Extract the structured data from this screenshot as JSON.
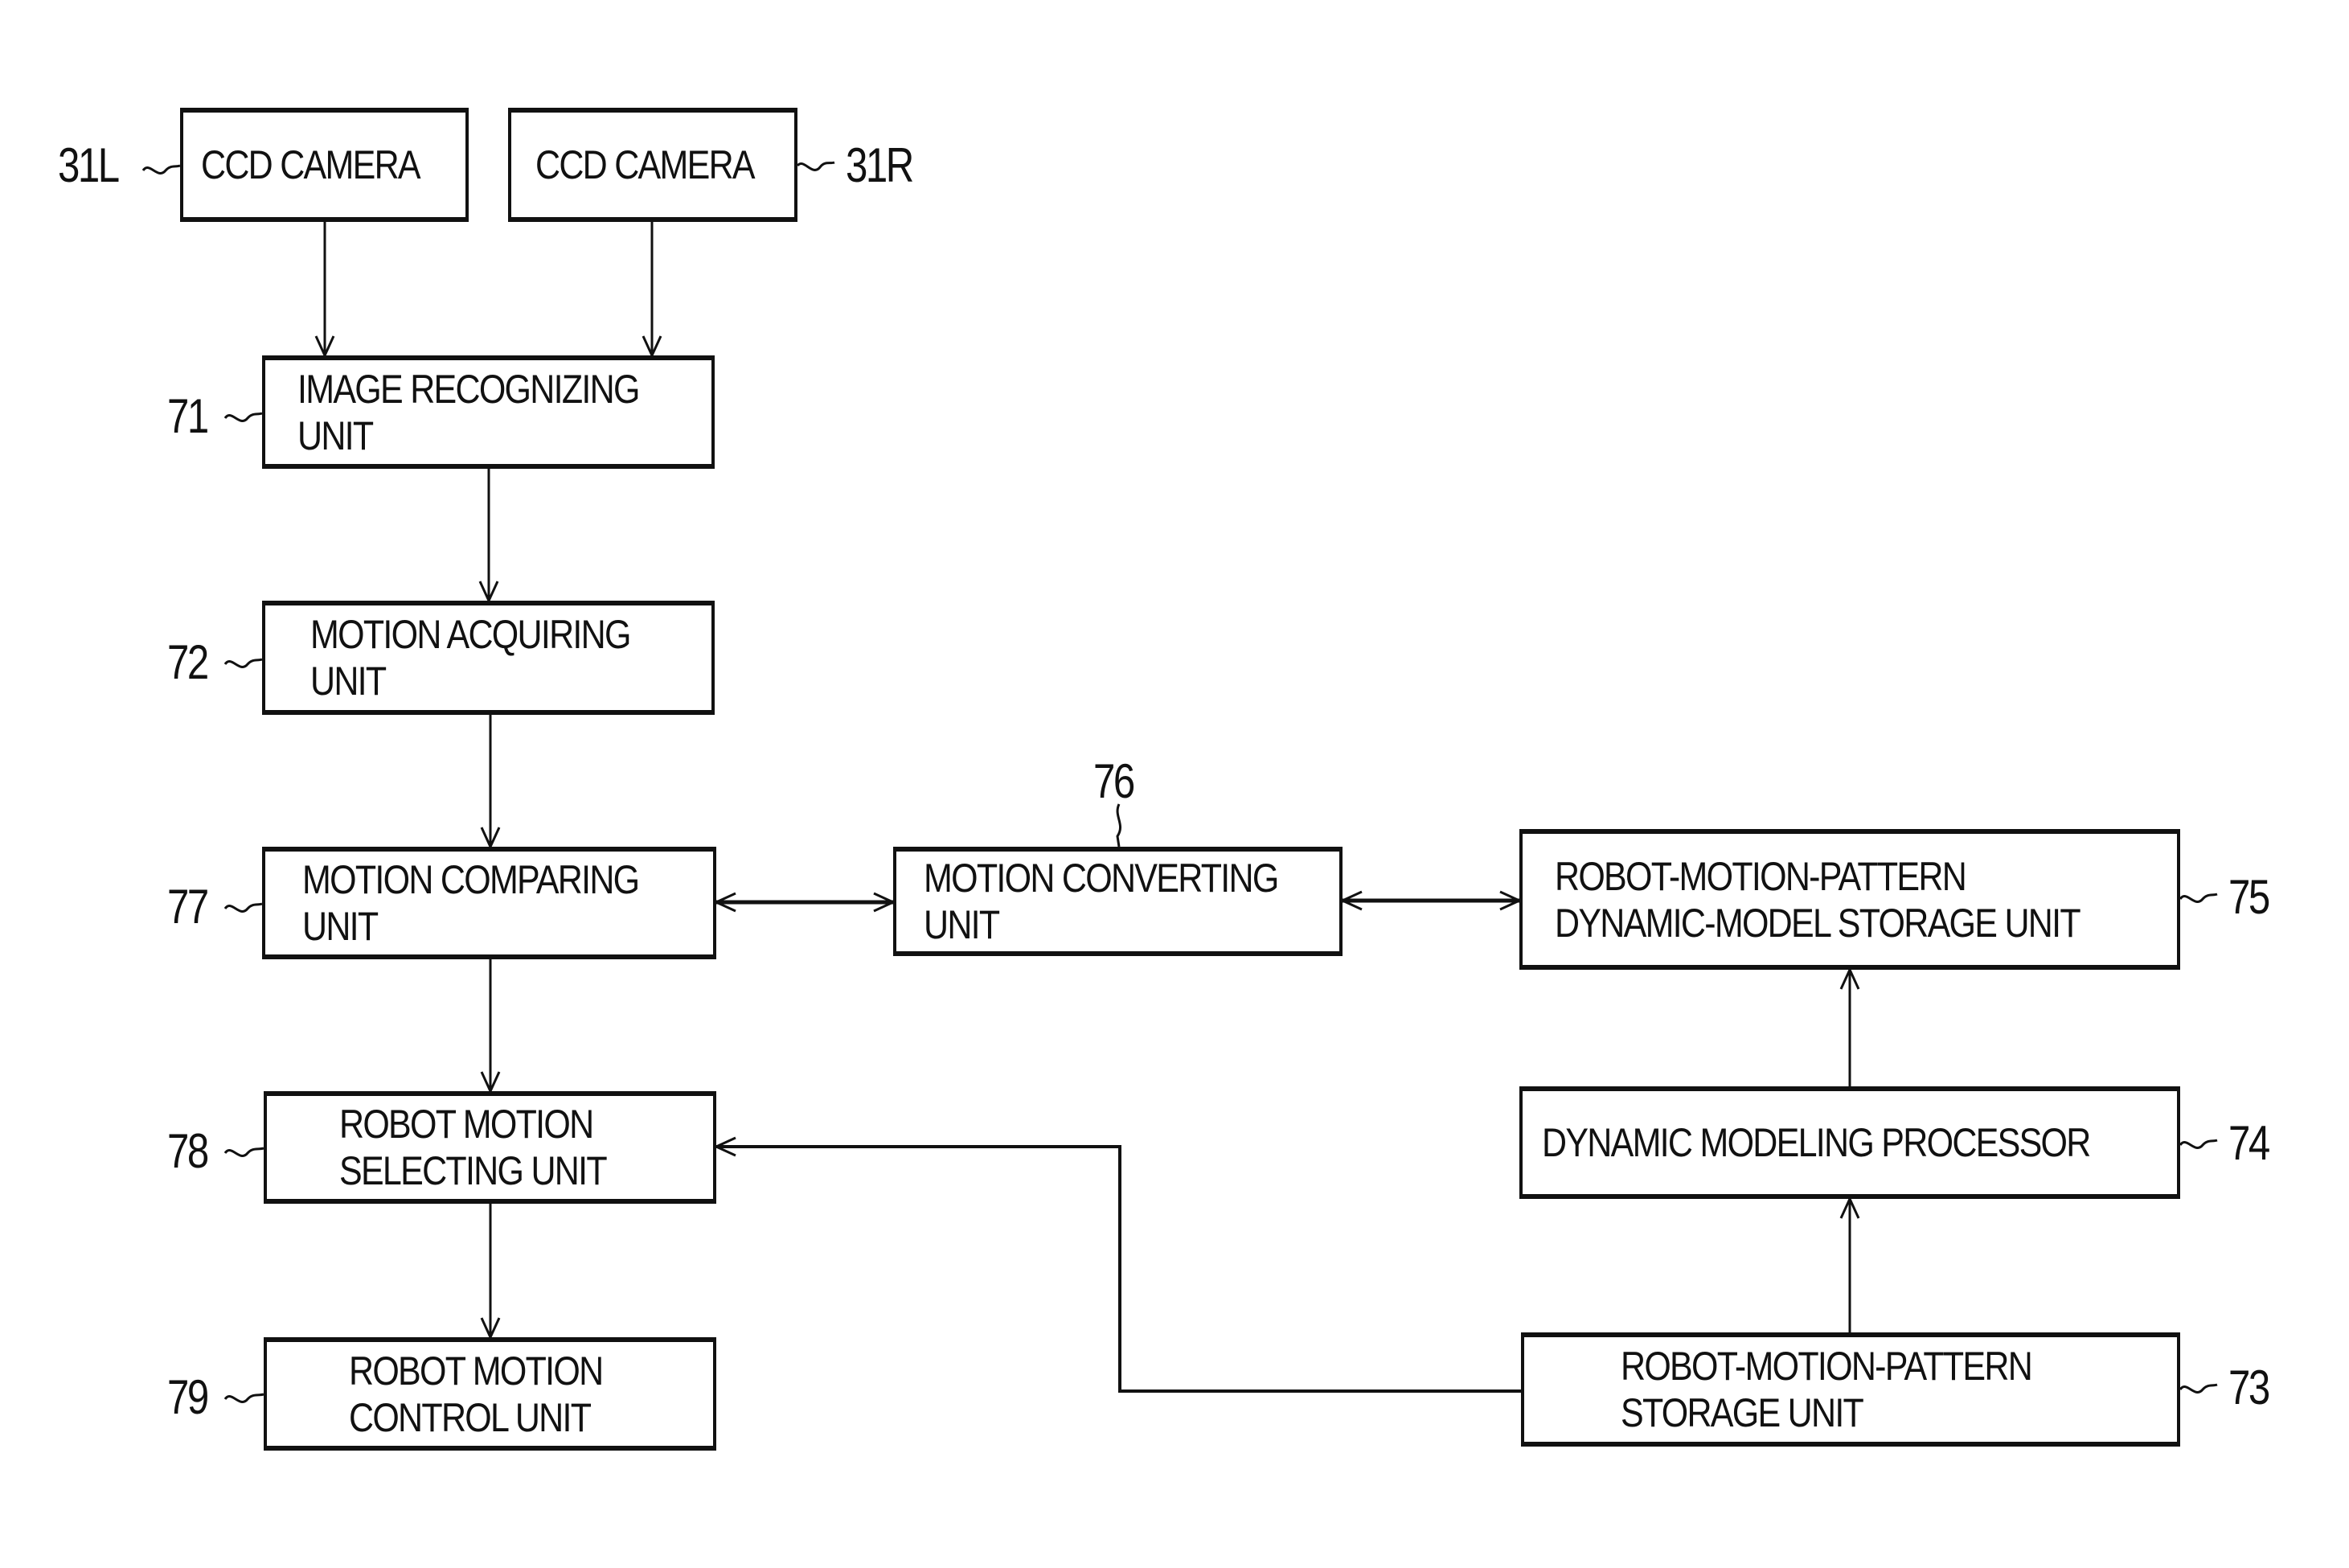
{
  "diagram": {
    "blocks": [
      {
        "id": "31L",
        "ref": "31L",
        "lines": [
          "CCD CAMERA"
        ]
      },
      {
        "id": "31R",
        "ref": "31R",
        "lines": [
          "CCD CAMERA"
        ]
      },
      {
        "id": "71",
        "ref": "71",
        "lines": [
          "IMAGE RECOGNIZING",
          "UNIT"
        ]
      },
      {
        "id": "72",
        "ref": "72",
        "lines": [
          "MOTION ACQUIRING",
          "UNIT"
        ]
      },
      {
        "id": "77",
        "ref": "77",
        "lines": [
          "MOTION COMPARING",
          "UNIT"
        ]
      },
      {
        "id": "78",
        "ref": "78",
        "lines": [
          "ROBOT MOTION",
          "SELECTING UNIT"
        ]
      },
      {
        "id": "79",
        "ref": "79",
        "lines": [
          "ROBOT MOTION",
          "CONTROL UNIT"
        ]
      },
      {
        "id": "76",
        "ref": "76",
        "lines": [
          "MOTION CONVERTING",
          "UNIT"
        ]
      },
      {
        "id": "75",
        "ref": "75",
        "lines": [
          "ROBOT-MOTION-PATTERN",
          "DYNAMIC-MODEL STORAGE UNIT"
        ]
      },
      {
        "id": "74",
        "ref": "74",
        "lines": [
          "DYNAMIC MODELING PROCESSOR"
        ]
      },
      {
        "id": "73",
        "ref": "73",
        "lines": [
          "ROBOT-MOTION-PATTERN",
          "STORAGE UNIT"
        ]
      }
    ],
    "connections": [
      {
        "from": "31L",
        "to": "71",
        "type": "arrow"
      },
      {
        "from": "31R",
        "to": "71",
        "type": "arrow"
      },
      {
        "from": "71",
        "to": "72",
        "type": "arrow"
      },
      {
        "from": "72",
        "to": "77",
        "type": "arrow"
      },
      {
        "from": "77",
        "to": "76",
        "type": "bidirectional"
      },
      {
        "from": "76",
        "to": "75",
        "type": "bidirectional"
      },
      {
        "from": "77",
        "to": "78",
        "type": "arrow"
      },
      {
        "from": "78",
        "to": "79",
        "type": "arrow"
      },
      {
        "from": "73",
        "to": "74",
        "type": "arrow"
      },
      {
        "from": "74",
        "to": "75",
        "type": "arrow"
      },
      {
        "from": "73",
        "to": "78",
        "type": "arrow"
      }
    ]
  }
}
